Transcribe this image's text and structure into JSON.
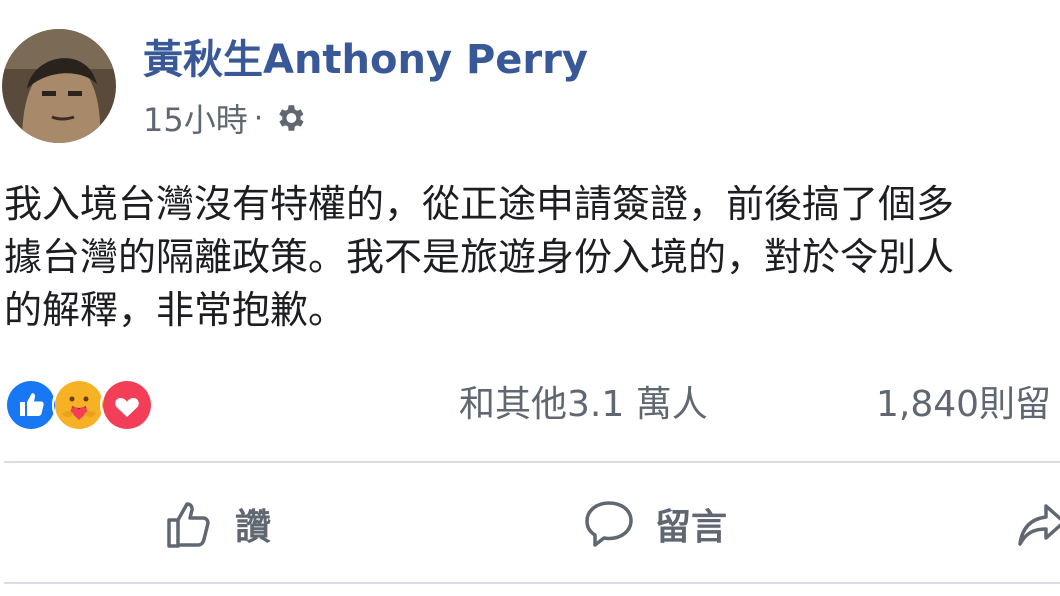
{
  "post": {
    "author": "黃秋生Anthony Perry",
    "timestamp": "15小時",
    "meta_separator": "·",
    "audience_icon": "gear-icon",
    "body_lines": [
      "我入境台灣沒有特權的，從正途申請簽證，前後搞了個多",
      "據台灣的隔離政策。我不是旅遊身份入境的，對於令別人",
      "的解釋，非常抱歉。"
    ]
  },
  "reactions": {
    "icons": [
      "like-reaction-icon",
      "care-reaction-icon",
      "love-reaction-icon"
    ],
    "others_text": "和其他3.1 萬人",
    "comments_text": "1,840則留"
  },
  "actions": {
    "like_label": "讚",
    "comment_label": "留言"
  },
  "colors": {
    "author_link": "#385898",
    "secondary_text": "#606770",
    "body_text": "#1c1e21",
    "like_blue": "#1877f2",
    "love_red": "#f33e58",
    "care_yellow": "#f7b125",
    "divider": "#dadde1"
  }
}
